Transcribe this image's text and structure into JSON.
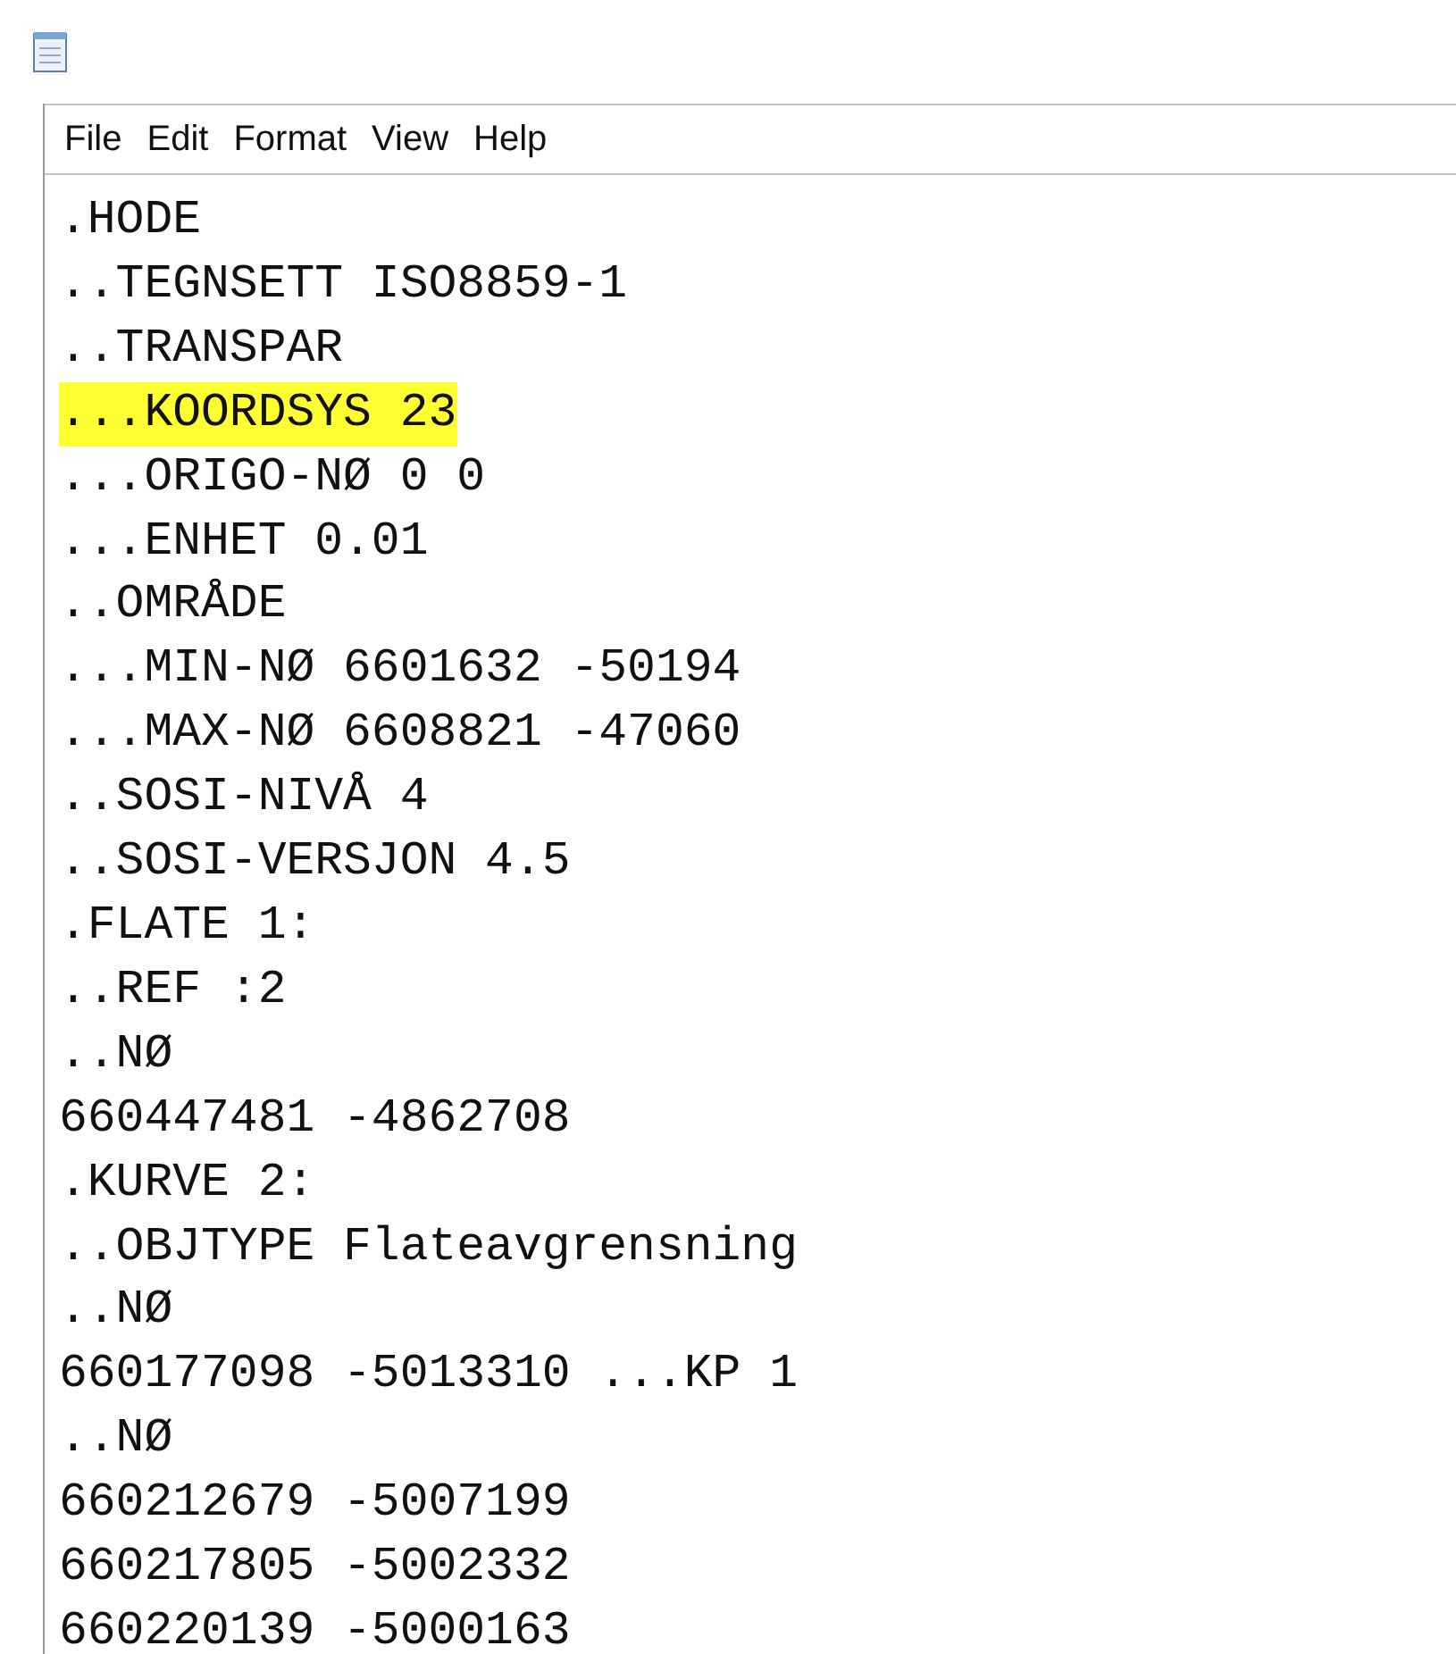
{
  "menu_bar": {
    "items": [
      "File",
      "Edit",
      "Format",
      "View",
      "Help"
    ]
  },
  "editor": {
    "lines": [
      {
        "text": ".HODE",
        "highlighted": false
      },
      {
        "text": "..TEGNSETT ISO8859-1",
        "highlighted": false
      },
      {
        "text": "..TRANSPAR",
        "highlighted": false
      },
      {
        "text": "...KOORDSYS 23",
        "highlighted": true
      },
      {
        "text": "...ORIGO-NØ 0 0",
        "highlighted": false
      },
      {
        "text": "...ENHET 0.01",
        "highlighted": false
      },
      {
        "text": "..OMRÅDE",
        "highlighted": false
      },
      {
        "text": "...MIN-NØ 6601632 -50194",
        "highlighted": false
      },
      {
        "text": "...MAX-NØ 6608821 -47060",
        "highlighted": false
      },
      {
        "text": "..SOSI-NIVÅ 4",
        "highlighted": false
      },
      {
        "text": "..SOSI-VERSJON 4.5",
        "highlighted": false
      },
      {
        "text": ".FLATE 1:",
        "highlighted": false
      },
      {
        "text": "..REF :2",
        "highlighted": false
      },
      {
        "text": "..NØ",
        "highlighted": false
      },
      {
        "text": "660447481 -4862708",
        "highlighted": false
      },
      {
        "text": ".KURVE 2:",
        "highlighted": false
      },
      {
        "text": "..OBJTYPE Flateavgrensning",
        "highlighted": false
      },
      {
        "text": "..NØ",
        "highlighted": false
      },
      {
        "text": "660177098 -5013310 ...KP 1",
        "highlighted": false
      },
      {
        "text": "..NØ",
        "highlighted": false
      },
      {
        "text": "660212679 -5007199",
        "highlighted": false
      },
      {
        "text": "660217805 -5002332",
        "highlighted": false
      },
      {
        "text": "660220139 -5000163",
        "highlighted": false
      }
    ]
  }
}
